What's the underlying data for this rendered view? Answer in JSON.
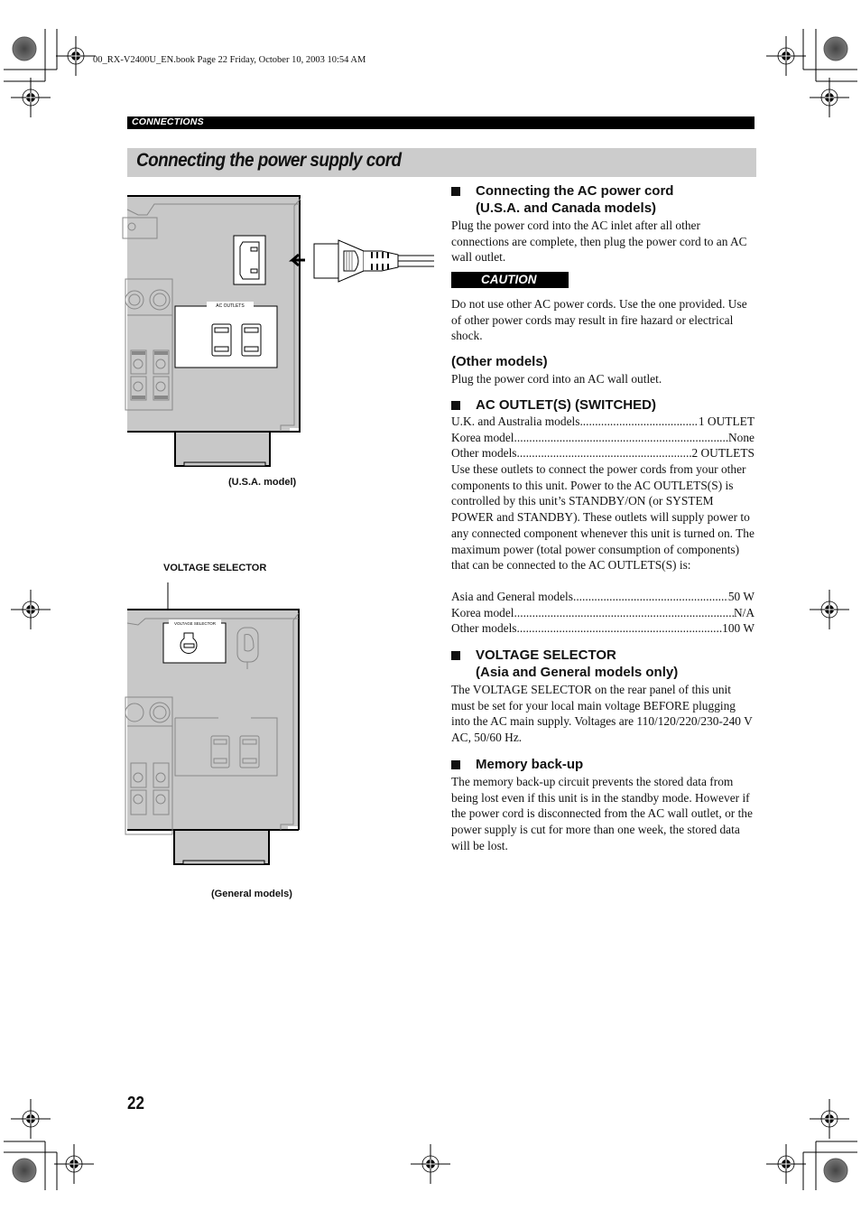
{
  "print_meta": "00_RX-V2400U_EN.book  Page 22  Friday, October 10, 2003  10:54 AM",
  "section_label": "CONNECTIONS",
  "page_title": "Connecting the power supply cord",
  "figures": {
    "usa": {
      "caption": "(U.S.A. model)",
      "panel_label": "AC OUTLETS"
    },
    "general": {
      "caption": "(General models)",
      "callout": "VOLTAGE SELECTOR",
      "panel_label": "VOLTAGE SELECTOR"
    }
  },
  "sections": {
    "ac_cord": {
      "heading_line1": "Connecting the AC power cord",
      "heading_line2": "(U.S.A. and Canada models)",
      "body": "Plug the power cord into the AC inlet after all other connections are complete, then plug the power cord to an AC wall outlet.",
      "caution_label": "CAUTION",
      "caution_text": "Do not use other AC power cords. Use the one provided. Use of other power cords may result in fire hazard or electrical shock.",
      "other_heading": "(Other models)",
      "other_body": "Plug the power cord into an AC wall outlet."
    },
    "ac_outlets": {
      "heading": "AC OUTLET(S) (SWITCHED)",
      "outlet_counts": [
        {
          "label": "U.K. and Australia models",
          "value": " 1 OUTLET"
        },
        {
          "label": "Korea model",
          "value": "None"
        },
        {
          "label": "Other models",
          "value": "2 OUTLETS"
        }
      ],
      "body": "Use these outlets to connect the power cords from your other components to this unit. Power to the AC OUTLETS(S) is controlled by this unit’s STANDBY/ON (or SYSTEM POWER and STANDBY). These outlets will supply power to any connected component whenever this unit is turned on. The maximum power (total power consumption of components) that can be connected to the AC OUTLETS(S) is:",
      "max_power": [
        {
          "label": "Asia and General models",
          "value": " 50 W"
        },
        {
          "label": "Korea model",
          "value": "N/A"
        },
        {
          "label": "Other models ",
          "value": "100 W"
        }
      ]
    },
    "voltage_selector": {
      "heading_line1": "VOLTAGE SELECTOR",
      "heading_line2": "(Asia and General models only)",
      "body": "The VOLTAGE SELECTOR on the rear panel of this unit must be set for your local main voltage BEFORE plugging into the AC main supply. Voltages are 110/120/220/230-240 V AC, 50/60 Hz."
    },
    "memory_backup": {
      "heading": "Memory back-up",
      "body": "The memory back-up circuit prevents the stored data from being lost even if this unit is in the standby mode. However if the power cord is disconnected from the AC wall outlet, or the power supply is cut for more than one week, the stored data will be lost."
    }
  },
  "page_number": "22"
}
